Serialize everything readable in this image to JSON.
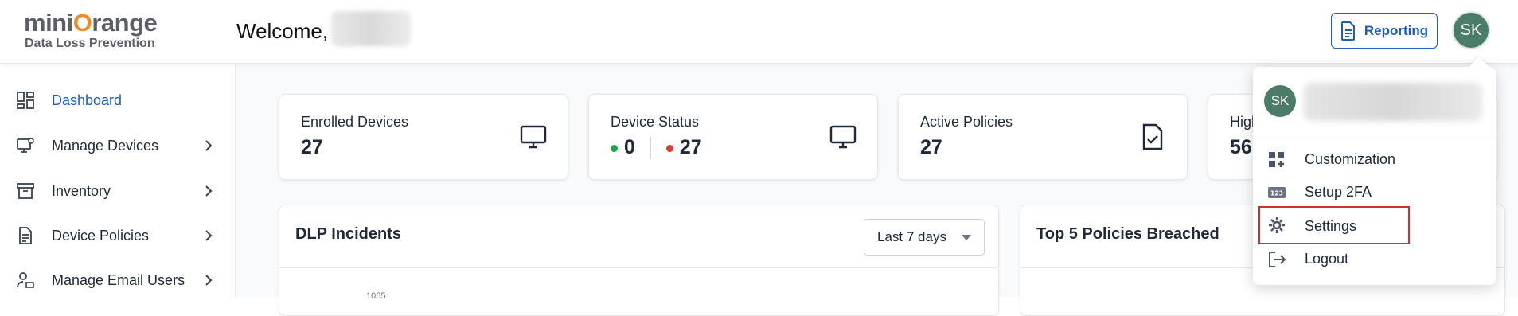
{
  "header": {
    "logo_main_prefix": "mini",
    "logo_main_o": "O",
    "logo_main_suffix": "range",
    "logo_sub": "Data Loss Prevention",
    "welcome": "Welcome,",
    "reporting_label": "Reporting",
    "avatar_initials": "SK"
  },
  "sidebar": {
    "items": [
      {
        "label": "Dashboard",
        "icon": "dashboard-icon",
        "active": true
      },
      {
        "label": "Manage Devices",
        "icon": "devices-icon"
      },
      {
        "label": "Inventory",
        "icon": "inventory-icon"
      },
      {
        "label": "Device Policies",
        "icon": "policy-doc-icon"
      },
      {
        "label": "Manage Email Users",
        "icon": "email-users-icon"
      }
    ]
  },
  "cards": [
    {
      "title": "Enrolled Devices",
      "value": "27",
      "icon": "monitor-icon"
    },
    {
      "title": "Device Status",
      "online": "0",
      "offline": "27",
      "icon": "monitor-icon",
      "colors": {
        "online": "#22a447",
        "offline": "#e53935"
      }
    },
    {
      "title": "Active Policies",
      "value": "27",
      "icon": "policy-check-icon"
    },
    {
      "title": "High",
      "value": "56"
    }
  ],
  "panels": {
    "incidents": {
      "title": "DLP Incidents",
      "range": "Last 7 days",
      "axis_tick": "1065"
    },
    "top_policies": {
      "title": "Top 5 Policies Breached"
    }
  },
  "profile_menu": {
    "avatar_initials": "SK",
    "items": [
      {
        "label": "Customization",
        "icon": "customization-icon"
      },
      {
        "label": "Setup 2FA",
        "icon": "2fa-icon"
      },
      {
        "label": "Settings",
        "icon": "gear-icon",
        "highlighted": true
      },
      {
        "label": "Logout",
        "icon": "logout-icon"
      }
    ]
  },
  "colors": {
    "brand_blue": "#1d5fb3",
    "avatar_green": "#4a7c68",
    "logo_orange": "#f08a24",
    "highlight_red": "#d32f2f"
  }
}
